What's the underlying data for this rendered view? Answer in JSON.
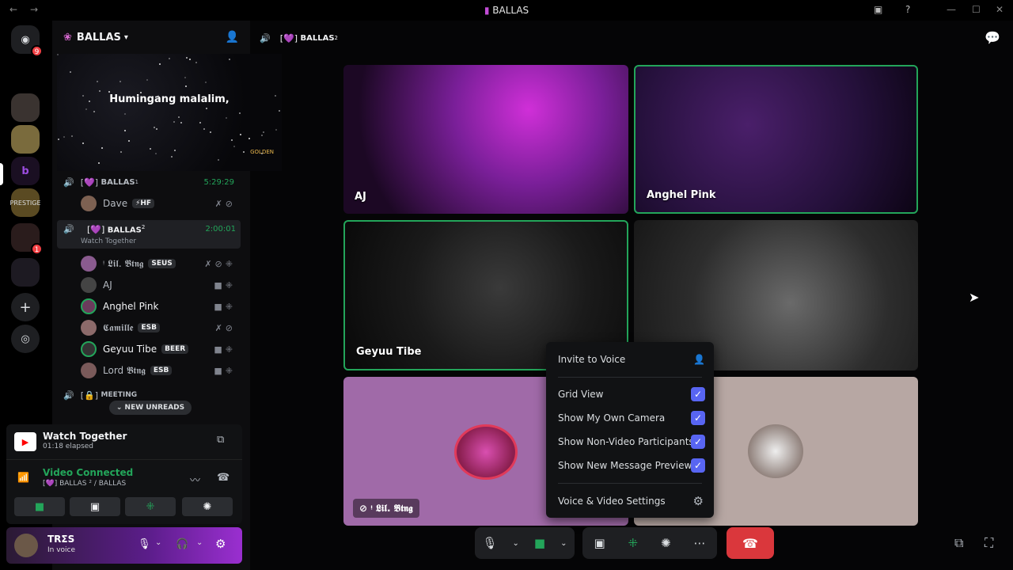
{
  "window": {
    "title": "BALLAS"
  },
  "rail": {
    "badge_top": "9",
    "badge_mid": "1"
  },
  "server": {
    "name": "BALLAS"
  },
  "header": {
    "channel_prefix": "[💜]",
    "channel": "BALLAS",
    "channel_sup": "2"
  },
  "activity": {
    "caption": "Humingang malalim,",
    "watermark": "GOLDEN"
  },
  "channels": [
    {
      "prefix": "[💜]",
      "name": "BALLAS",
      "sup": "1",
      "timer": "5:29:29"
    },
    {
      "prefix": "[💜]",
      "name": "BALLAS",
      "sup": "2",
      "timer": "2:00:01",
      "sub": "Watch Together"
    },
    {
      "prefix": "[🔒]",
      "name": "MEETING"
    }
  ],
  "members_ch1": [
    {
      "name": "Dave",
      "tag": "⚡HF"
    }
  ],
  "members_ch2": [
    {
      "name": "ᵎ 𝕷𝖎𝖑. 𝕭𝖙𝖓𝖌",
      "tag": "SEUS"
    },
    {
      "name": "AJ",
      "tag": ""
    },
    {
      "name": "Anghel Pink",
      "tag": ""
    },
    {
      "name": "𝕮𝖆𝖒𝖎𝖑𝖑𝖊",
      "tag": "ESB"
    },
    {
      "name": "Geyuu Tibe",
      "tag": "BEER"
    },
    {
      "name": "Lord 𝕭𝖙𝖓𝖌",
      "tag": "ESB"
    }
  ],
  "new_unreads": "NEW UNREADS",
  "watch": {
    "title": "Watch Together",
    "elapsed": "01:18 elapsed"
  },
  "voice": {
    "status": "Video Connected",
    "location": "[💜] BALLAS ² / BALLAS"
  },
  "user": {
    "name": "TRΣS",
    "status": "In voice"
  },
  "tiles": [
    {
      "name": "AJ"
    },
    {
      "name": "Anghel Pink"
    },
    {
      "name": "Geyuu Tibe"
    },
    {
      "name": ""
    },
    {
      "name": "ᵎ 𝕷𝖎𝖑. 𝕭𝖙𝖓𝖌"
    },
    {
      "name": ""
    }
  ],
  "menu": {
    "invite": "Invite to Voice",
    "grid": "Grid View",
    "own_camera": "Show My Own Camera",
    "non_video": "Show Non-Video Participants",
    "previews": "Show New Message Previews",
    "settings": "Voice & Video Settings"
  },
  "colors": {
    "accent": "#5865f2",
    "green": "#23a55a",
    "red": "#da373c"
  }
}
